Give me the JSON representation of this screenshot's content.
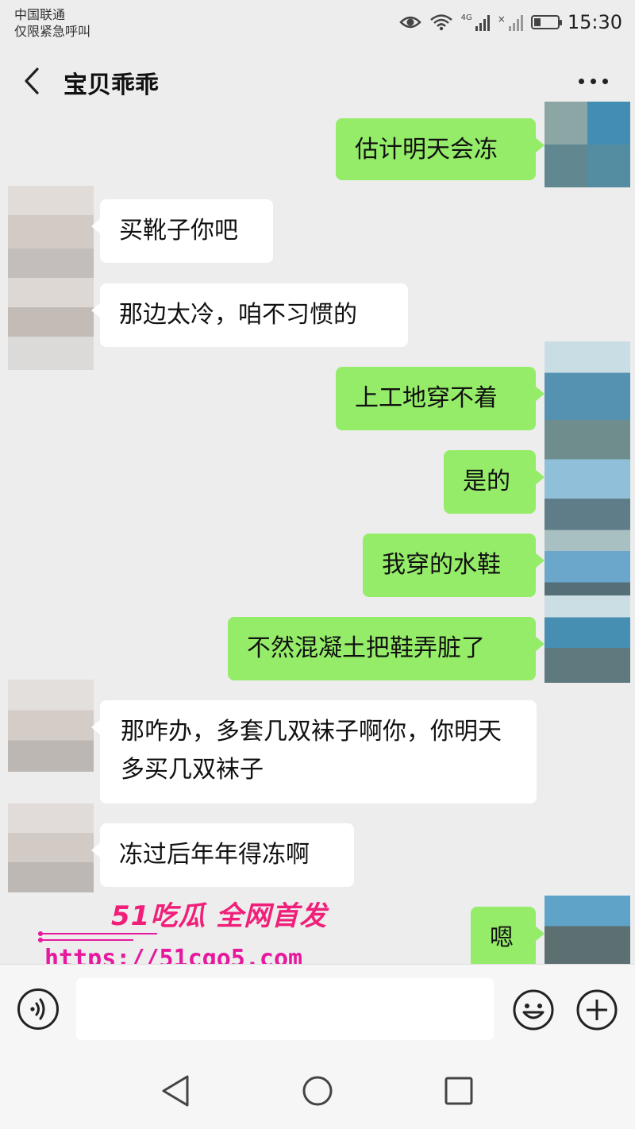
{
  "status_bar": {
    "carrier": "中国联通",
    "carrier_note": "仅限紧急呼叫",
    "time": "15:30",
    "icons": [
      "eye-icon",
      "wifi-icon",
      "signal-4g-icon",
      "signal-icon",
      "battery-icon"
    ]
  },
  "header": {
    "title": "宝贝乖乖",
    "back_icon": "chevron-left-icon",
    "more_icon": "more-dots-icon"
  },
  "messages": [
    {
      "side": "self",
      "text": "估计明天会冻"
    },
    {
      "side": "peer",
      "text": "买靴子你吧"
    },
    {
      "side": "peer",
      "text": "那边太冷，咱不习惯的"
    },
    {
      "side": "self",
      "text": "上工地穿不着"
    },
    {
      "side": "self",
      "text": "是的"
    },
    {
      "side": "self",
      "text": "我穿的水鞋"
    },
    {
      "side": "self",
      "text": "不然混凝土把鞋弄脏了"
    },
    {
      "side": "peer",
      "text": "那咋办，多套几双袜子啊你，你明天多买几双袜子"
    },
    {
      "side": "peer",
      "text": "冻过后年年得冻啊"
    },
    {
      "side": "self",
      "text": "嗯"
    }
  ],
  "watermark": {
    "brand": "51吃瓜 全网首发",
    "url": "https://51cgo5.com"
  },
  "input_bar": {
    "value": "",
    "voice_icon": "voice-icon",
    "emoji_icon": "emoji-icon",
    "plus_icon": "plus-icon"
  },
  "nav_bar": {
    "icons": [
      "nav-back-icon",
      "nav-home-icon",
      "nav-recents-icon"
    ]
  },
  "colors": {
    "background": "#ededed",
    "outgoing_bubble": "#95ec69",
    "incoming_bubble": "#ffffff",
    "watermark": "#f0207a"
  }
}
